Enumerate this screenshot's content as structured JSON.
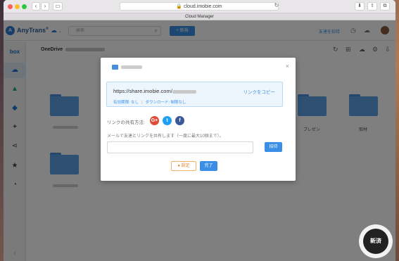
{
  "browser": {
    "url": "cloud.imobie.com",
    "tab_title": "Cloud Manager"
  },
  "app": {
    "name": "AnyTrans",
    "name_suffix": "®",
    "search_placeholder": "検索",
    "new_button": "+ 新規",
    "invite_friend": "友達を招待"
  },
  "sidebar": {
    "items": [
      "box-icon",
      "onedrive-icon",
      "google-drive-icon",
      "dropbox-icon",
      "add-icon",
      "share-icon",
      "star-icon",
      "clock-icon"
    ],
    "box_label": "box"
  },
  "content": {
    "path": "OneDrive",
    "folders_bottom_right": [
      "プレゼン",
      "取材"
    ]
  },
  "modal": {
    "link_url": "https://share.imobie.com/",
    "copy_link": "リンクをコピー",
    "expiry": "有効期限: なし",
    "download": "ダウンロード: 制限なし",
    "share_method_label": "リンクの共有方法:",
    "email_label": "メールで友達とリンクを共有します（一度に最大10個まで）。",
    "invite_button": "招待",
    "settings_button": "設定",
    "done_button": "完了"
  },
  "social": [
    {
      "name": "google-plus",
      "glyph": "G+",
      "color": "#dd4b39"
    },
    {
      "name": "twitter",
      "glyph": "t",
      "color": "#1da1f2"
    },
    {
      "name": "facebook",
      "glyph": "f",
      "color": "#3b5998"
    }
  ],
  "watermark": {
    "text": "新済"
  }
}
